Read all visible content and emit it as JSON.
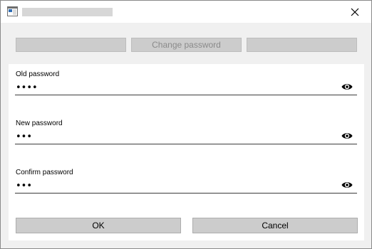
{
  "window": {
    "title": ""
  },
  "tabs": [
    {
      "label": ""
    },
    {
      "label": "Change password"
    },
    {
      "label": ""
    }
  ],
  "fields": {
    "old": {
      "label": "Old password",
      "value": "1234"
    },
    "new": {
      "label": "New password",
      "value": "123"
    },
    "confirm": {
      "label": "Confirm password",
      "value": "123"
    }
  },
  "buttons": {
    "ok": "OK",
    "cancel": "Cancel"
  },
  "icons": {
    "app": "window-app-icon",
    "close": "close-icon",
    "reveal": "eye-icon"
  }
}
